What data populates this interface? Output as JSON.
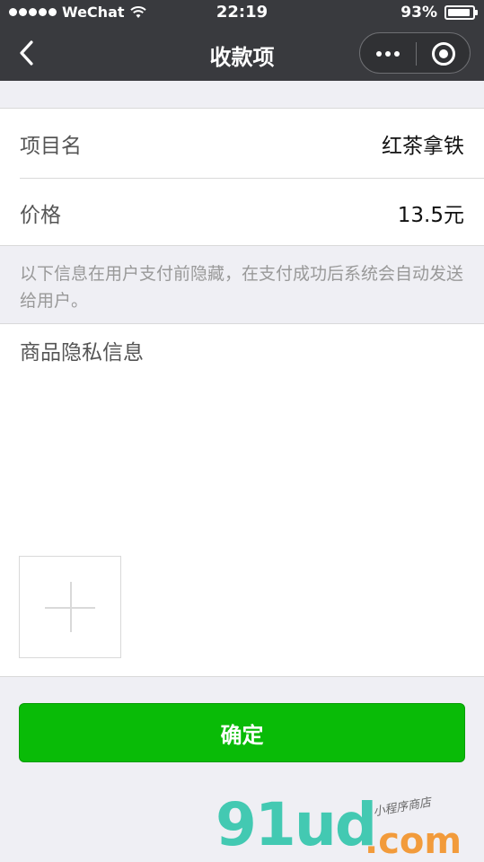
{
  "status_bar": {
    "carrier": "WeChat",
    "time": "22:19",
    "battery_percent": "93%",
    "battery_level": 0.93,
    "signal_dots": 5
  },
  "nav": {
    "title": "收款项",
    "back_icon": "chevron-left-icon",
    "more_icon": "more-dots-icon",
    "close_icon": "target-close-icon"
  },
  "form": {
    "item_name_label": "项目名",
    "item_name_value": "红茶拿铁",
    "price_label": "价格",
    "price_value": "13.5元"
  },
  "notice": "以下信息在用户支付前隐藏，在支付成功后系统会自动发送给用户。",
  "private_info": {
    "title": "商品隐私信息",
    "upload_icon": "plus-icon"
  },
  "confirm_label": "确定",
  "watermark": {
    "logo": "91ud",
    "domain": ".com",
    "tagline": "小程序商店"
  },
  "colors": {
    "nav_bg": "#393a3e",
    "page_bg": "#efeff4",
    "primary_green": "#09bb07",
    "watermark_teal": "#43c9b2",
    "watermark_orange": "#f29b3b"
  }
}
